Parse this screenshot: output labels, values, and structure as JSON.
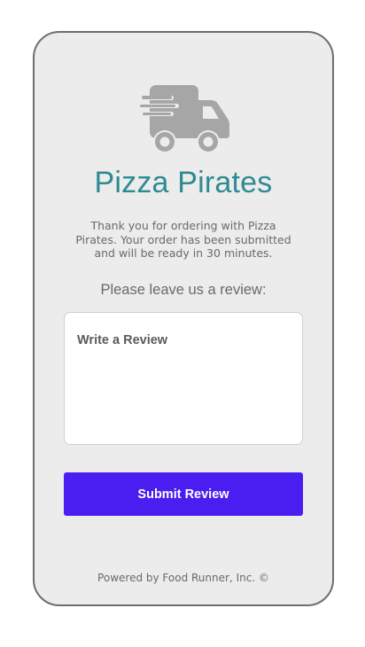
{
  "app": {
    "brand_name": "Pizza Pirates",
    "logo_icon": "delivery-truck-icon"
  },
  "confirmation": {
    "message": "Thank you for ordering with Pizza Pirates. Your order has been submitted and will be ready in 30 minutes."
  },
  "review": {
    "prompt": "Please leave us a review:",
    "placeholder": "Write a Review",
    "value": "",
    "submit_label": "Submit Review"
  },
  "footer": {
    "text": "Powered by Food Runner, Inc. ©"
  },
  "colors": {
    "brand": "#2e8b92",
    "accent": "#4a1ef0",
    "icon": "#a6a6a6",
    "background": "#ececec"
  }
}
